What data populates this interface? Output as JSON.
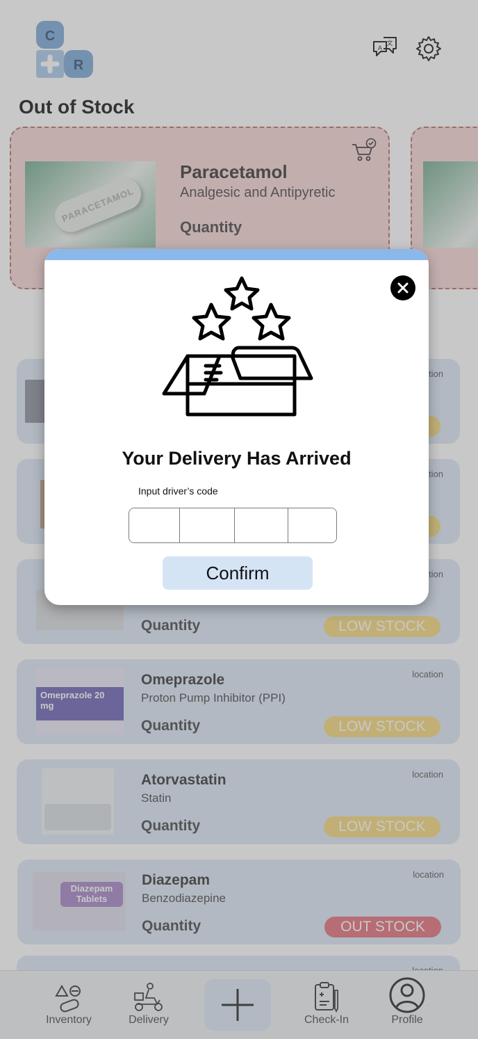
{
  "header": {
    "logo_letters": [
      "C",
      "R"
    ],
    "translate_icon": "translate-icon",
    "settings_icon": "gear-icon"
  },
  "out_of_stock": {
    "title": "Out of Stock",
    "card": {
      "name": "Paracetamol",
      "subtitle": "Analgesic and Antipyretic",
      "quantity_label": "Quantity",
      "image_text": "PARACETAMOL"
    }
  },
  "inventory": [
    {
      "name": "",
      "subtitle": "",
      "quantity_label": "",
      "location": "location",
      "status": ""
    },
    {
      "name": "",
      "subtitle": "",
      "quantity_label": "",
      "location": "location",
      "status": ""
    },
    {
      "name": "",
      "subtitle": "",
      "quantity_label": "Quantity",
      "location": "location",
      "status": "LOW STOCK"
    },
    {
      "name": "Omeprazole",
      "subtitle": "Proton Pump Inhibitor (PPI)",
      "quantity_label": "Quantity",
      "location": "location",
      "status": "LOW STOCK",
      "box_text": "Omeprazole 20 mg"
    },
    {
      "name": "Atorvastatin",
      "subtitle": "Statin",
      "quantity_label": "Quantity",
      "location": "location",
      "status": "LOW STOCK"
    },
    {
      "name": "Diazepam",
      "subtitle": "Benzodiazepine",
      "quantity_label": "Quantity",
      "location": "location",
      "status": "OUT STOCK",
      "box_text": "Diazepam Tablets"
    },
    {
      "location": "location"
    }
  ],
  "nav": {
    "items": [
      {
        "label": "Inventory",
        "icon": "inventory-icon"
      },
      {
        "label": "Delivery",
        "icon": "delivery-scooter-icon"
      },
      {
        "label": "",
        "icon": "plus-icon"
      },
      {
        "label": "Check-In",
        "icon": "clipboard-icon"
      },
      {
        "label": "Profile",
        "icon": "profile-icon"
      }
    ]
  },
  "modal": {
    "title": "Your Delivery Has Arrived",
    "code_label": "Input driver’s code",
    "confirm_label": "Confirm",
    "code_values": [
      "",
      "",
      "",
      ""
    ],
    "close_icon": "close-icon",
    "art_icon": "delivery-box-stars-icon"
  },
  "colors": {
    "accent_blue": "#8ab8ea",
    "card_blue": "#dce7f6",
    "low_stock": "#f4d77a",
    "out_stock": "#e26d78"
  }
}
